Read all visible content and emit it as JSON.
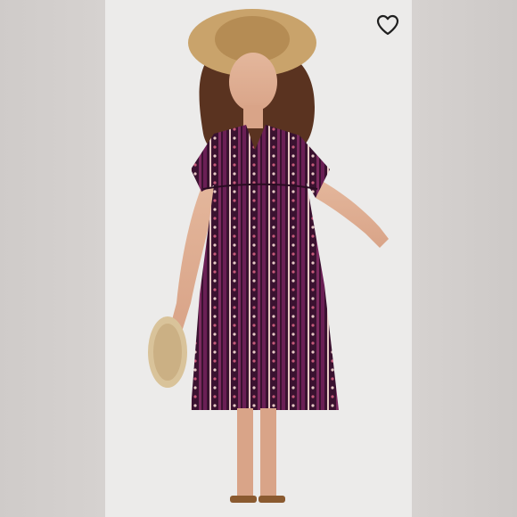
{
  "product_image": {
    "alt": "",
    "dress_colors": {
      "base": "#3a1230",
      "accent": "#6a1f55",
      "stripe_light": "#e7c9c5",
      "stripe_pink": "#c75a7a"
    },
    "background_color": "#ecebea"
  },
  "favorite_button": {
    "icon": "heart-icon",
    "state": "not-liked",
    "color": "#1f1f1f"
  }
}
